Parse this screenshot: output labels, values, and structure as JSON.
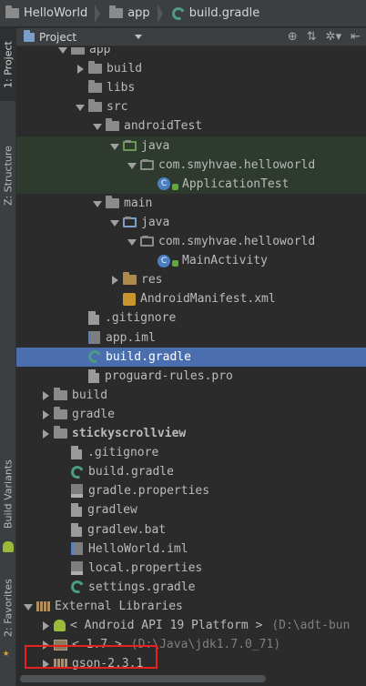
{
  "breadcrumb": [
    {
      "label": "HelloWorld",
      "icon": "folder-icon"
    },
    {
      "label": "app",
      "icon": "folder-icon"
    },
    {
      "label": "build.gradle",
      "icon": "gradle-icon"
    }
  ],
  "side_tabs": {
    "project": "1: Project",
    "structure": "Z: Structure",
    "build_variants": "Build Variants",
    "favorites": "2: Favorites"
  },
  "panel": {
    "view_selector": "Project",
    "tool_icons": [
      "target-icon",
      "collapse-icon",
      "settings-icon",
      "hide-icon"
    ]
  },
  "tree": [
    {
      "label": "app",
      "indent": 2,
      "arrow": "down",
      "icon": "folder",
      "partial": true
    },
    {
      "label": "build",
      "indent": 3,
      "arrow": "right",
      "icon": "folder"
    },
    {
      "label": "libs",
      "indent": 3,
      "arrow": "",
      "icon": "folder"
    },
    {
      "label": "src",
      "indent": 3,
      "arrow": "down",
      "icon": "folder"
    },
    {
      "label": "androidTest",
      "indent": 4,
      "arrow": "down",
      "icon": "folder"
    },
    {
      "label": "java",
      "indent": 5,
      "arrow": "down",
      "icon": "folder-green",
      "test": true
    },
    {
      "label": "com.smyhvae.helloworld",
      "indent": 6,
      "arrow": "down",
      "icon": "package",
      "test": true
    },
    {
      "label": "ApplicationTest",
      "indent": 7,
      "arrow": "",
      "icon": "class",
      "test": true
    },
    {
      "label": "main",
      "indent": 4,
      "arrow": "down",
      "icon": "folder"
    },
    {
      "label": "java",
      "indent": 5,
      "arrow": "down",
      "icon": "folder-blue"
    },
    {
      "label": "com.smyhvae.helloworld",
      "indent": 6,
      "arrow": "down",
      "icon": "package"
    },
    {
      "label": "MainActivity",
      "indent": 7,
      "arrow": "",
      "icon": "class"
    },
    {
      "label": "res",
      "indent": 5,
      "arrow": "right",
      "icon": "folder-res"
    },
    {
      "label": "AndroidManifest.xml",
      "indent": 5,
      "arrow": "",
      "icon": "xml"
    },
    {
      "label": ".gitignore",
      "indent": 3,
      "arrow": "",
      "icon": "file"
    },
    {
      "label": "app.iml",
      "indent": 3,
      "arrow": "",
      "icon": "iml"
    },
    {
      "label": "build.gradle",
      "indent": 3,
      "arrow": "",
      "icon": "gradle",
      "selected": true
    },
    {
      "label": "proguard-rules.pro",
      "indent": 3,
      "arrow": "",
      "icon": "file"
    },
    {
      "label": "build",
      "indent": 1,
      "arrow": "right",
      "icon": "folder"
    },
    {
      "label": "gradle",
      "indent": 1,
      "arrow": "right",
      "icon": "folder"
    },
    {
      "label": "stickyscrollview",
      "indent": 1,
      "arrow": "right",
      "icon": "folder-module",
      "bold": true
    },
    {
      "label": ".gitignore",
      "indent": 2,
      "arrow": "",
      "icon": "file"
    },
    {
      "label": "build.gradle",
      "indent": 2,
      "arrow": "",
      "icon": "gradle"
    },
    {
      "label": "gradle.properties",
      "indent": 2,
      "arrow": "",
      "icon": "props"
    },
    {
      "label": "gradlew",
      "indent": 2,
      "arrow": "",
      "icon": "file"
    },
    {
      "label": "gradlew.bat",
      "indent": 2,
      "arrow": "",
      "icon": "file"
    },
    {
      "label": "HelloWorld.iml",
      "indent": 2,
      "arrow": "",
      "icon": "iml"
    },
    {
      "label": "local.properties",
      "indent": 2,
      "arrow": "",
      "icon": "props"
    },
    {
      "label": "settings.gradle",
      "indent": 2,
      "arrow": "",
      "icon": "gradle"
    },
    {
      "label": "External Libraries",
      "indent": 0,
      "arrow": "down",
      "icon": "libraries"
    },
    {
      "label": "< Android API 19 Platform >",
      "indent": 1,
      "arrow": "right",
      "icon": "android",
      "dim": "(D:\\adt-bun"
    },
    {
      "label": "< 1.7 >",
      "indent": 1,
      "arrow": "right",
      "icon": "jdk",
      "dim": "(D:\\Java\\jdk1.7.0_71)"
    },
    {
      "label": "gson-2.3.1",
      "indent": 1,
      "arrow": "right",
      "icon": "library-jar",
      "highlighted": true
    }
  ],
  "colors": {
    "highlight": "#e8201e",
    "selection": "#4b6eaf",
    "background": "#2b2b2b"
  }
}
